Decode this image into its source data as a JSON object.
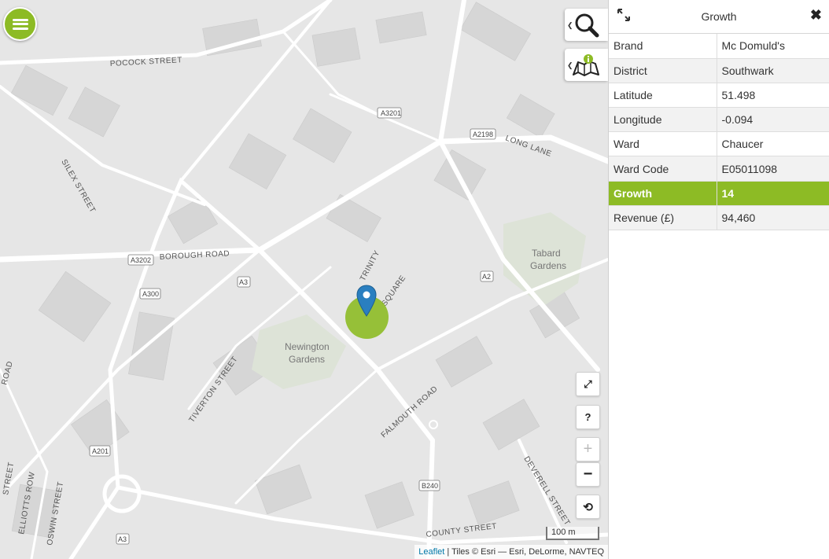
{
  "panel": {
    "title": "Growth",
    "rows": [
      {
        "key": "Brand",
        "value": "Mc Domuld's"
      },
      {
        "key": "District",
        "value": "Southwark"
      },
      {
        "key": "Latitude",
        "value": "51.498"
      },
      {
        "key": "Longitude",
        "value": "-0.094"
      },
      {
        "key": "Ward",
        "value": "Chaucer"
      },
      {
        "key": "Ward Code",
        "value": "E05011098"
      },
      {
        "key": "Growth",
        "value": "14",
        "highlight": true
      },
      {
        "key": "Revenue (£)",
        "value": "94,460"
      }
    ]
  },
  "map": {
    "streets": {
      "pocock": "POCOCK STREET",
      "silex": "SILEX STREET",
      "borough": "BOROUGH ROAD",
      "long_lane": "LONG LANE",
      "trinity": "TRINITY",
      "square": "SQUARE",
      "tiverton": "TIVERTON STREET",
      "falmouth": "FALMOUTH ROAD",
      "deverell": "DEVERELL STREET",
      "county": "COUNTY STREET",
      "elliotts": "ELLIOTTS ROW",
      "oswin": "OSWIN STREET",
      "street_left": "STREET",
      "road_left": "ROAD"
    },
    "shields": {
      "a3201": "A3201",
      "a2198": "A2198",
      "a3202": "A3202",
      "a3": "A3",
      "a300": "A300",
      "a2": "A2",
      "a201": "A201",
      "b240": "B240",
      "a3_bottom": "A3"
    },
    "parks": {
      "tabard_1": "Tabard",
      "tabard_2": "Gardens",
      "newington_1": "Newington",
      "newington_2": "Gardens"
    },
    "controls": {
      "help": "?",
      "zoom_in": "+",
      "zoom_out": "−",
      "reset": "⟲",
      "fullscreen": "⤢"
    },
    "scale": "100 m",
    "attribution_link": "Leaflet",
    "attribution_text": " | Tiles © Esri — Esri, DeLorme, NAVTEQ"
  },
  "colors": {
    "accent": "#8dbb25",
    "marker": "#2a7fc0"
  },
  "icons": {
    "menu": "hamburger-icon",
    "search": "magnifier-icon",
    "legend": "map-info-icon",
    "expand": "expand-icon",
    "close": "close-icon"
  }
}
